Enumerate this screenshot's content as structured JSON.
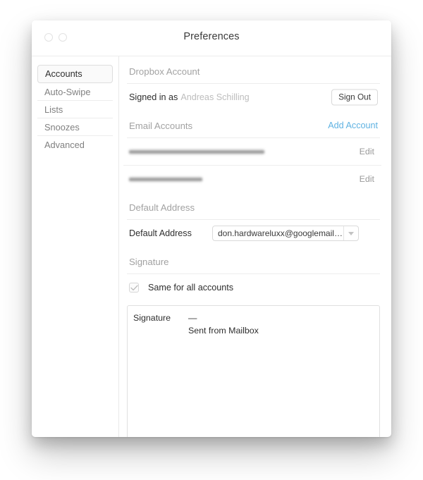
{
  "window": {
    "title": "Preferences",
    "controls": [
      {
        "name": "close-button"
      },
      {
        "name": "minimize-button"
      }
    ]
  },
  "sidebar": {
    "items": [
      {
        "label": "Accounts",
        "selected": true
      },
      {
        "label": "Auto-Swipe",
        "selected": false
      },
      {
        "label": "Lists",
        "selected": false
      },
      {
        "label": "Snoozes",
        "selected": false
      },
      {
        "label": "Advanced",
        "selected": false
      }
    ]
  },
  "sections": {
    "dropbox": {
      "header": "Dropbox Account",
      "signed_in_prefix": "Signed in as",
      "account_name": "Andreas Schilling",
      "sign_out_label": "Sign Out"
    },
    "email_accounts": {
      "header": "Email Accounts",
      "add_account_label": "Add Account",
      "rows": [
        {
          "address": "",
          "redacted": true,
          "edit_label": "Edit"
        },
        {
          "address": "",
          "redacted": true,
          "edit_label": "Edit"
        }
      ]
    },
    "default_address": {
      "header": "Default Address",
      "field_label": "Default Address",
      "value": "don.hardwareluxx@googlemail.com"
    },
    "signature": {
      "header": "Signature",
      "same_for_all_label": "Same for all accounts",
      "same_for_all_checked": true,
      "field_label": "Signature",
      "value": "—\nSent from Mailbox"
    }
  },
  "colors": {
    "link_blue": "#5fb2e2",
    "muted_text": "#a2a2a2",
    "body_text": "#2e2e2e"
  }
}
